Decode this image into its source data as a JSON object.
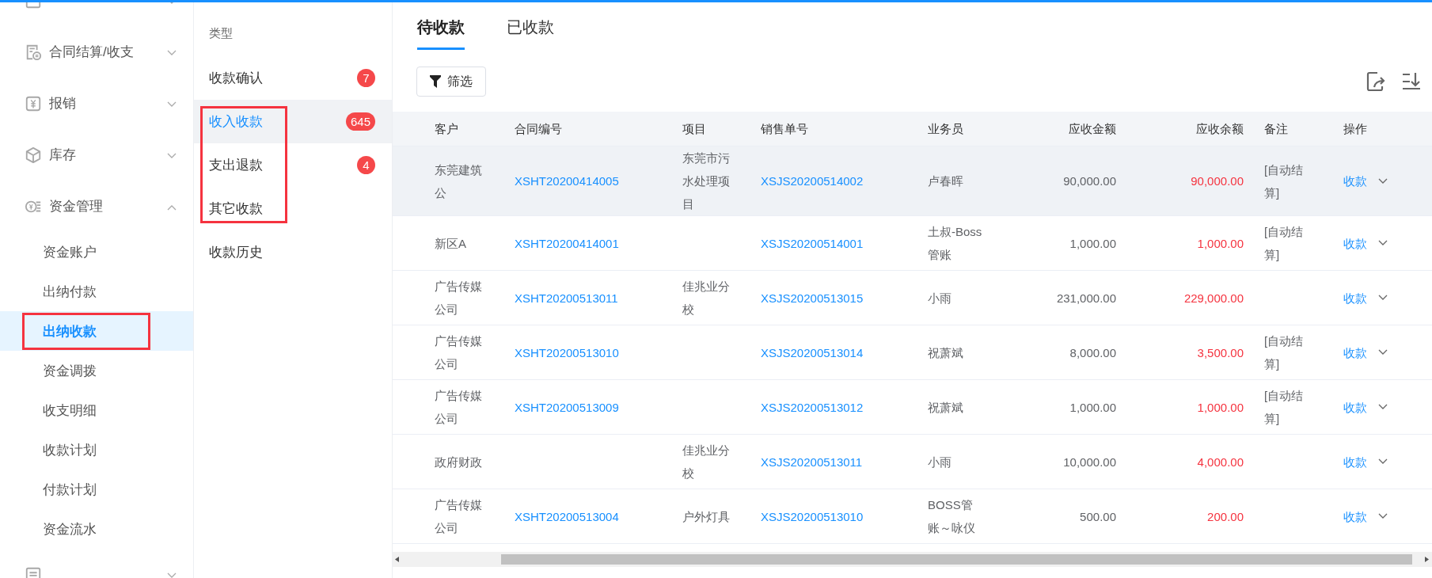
{
  "sidebar": {
    "items": [
      {
        "expanded": false
      },
      {
        "label": "合同结算/收支",
        "expanded": false
      },
      {
        "label": "报销",
        "expanded": false
      },
      {
        "label": "库存",
        "expanded": false
      },
      {
        "label": "资金管理",
        "expanded": true,
        "children": [
          {
            "label": "资金账户",
            "selected": false,
            "highlighted": false
          },
          {
            "label": "出纳付款",
            "selected": false,
            "highlighted": false
          },
          {
            "label": "出纳收款",
            "selected": true,
            "highlighted": true
          },
          {
            "label": "资金调拨",
            "selected": false,
            "highlighted": false
          },
          {
            "label": "收支明细",
            "selected": false,
            "highlighted": false
          },
          {
            "label": "收款计划",
            "selected": false,
            "highlighted": false
          },
          {
            "label": "付款计划",
            "selected": false,
            "highlighted": false
          },
          {
            "label": "资金流水",
            "selected": false,
            "highlighted": false
          }
        ]
      },
      {
        "expanded": false
      }
    ]
  },
  "category_panel": {
    "title": "类型",
    "items": [
      {
        "label": "收款确认",
        "count": "7",
        "selected": false,
        "highlighted": false
      },
      {
        "label": "收入收款",
        "count": "645",
        "selected": true,
        "highlighted": true
      },
      {
        "label": "支出退款",
        "count": "4",
        "selected": false,
        "highlighted": true
      },
      {
        "label": "其它收款",
        "selected": false,
        "highlighted": true
      },
      {
        "label": "收款历史",
        "selected": false,
        "highlighted": false
      }
    ]
  },
  "tabs": [
    {
      "label": "待收款",
      "selected": true
    },
    {
      "label": "已收款",
      "selected": false
    }
  ],
  "filter_button": "筛选",
  "table": {
    "columns": [
      "客户",
      "合同编号",
      "项目",
      "销售单号",
      "业务员",
      "应收金额",
      "应收余额",
      "备注",
      "操作"
    ],
    "rows": [
      {
        "hovered": true,
        "customer": "东莞建筑公",
        "contract_no": "XSHT20200414005",
        "project": "东莞市污水处理项目",
        "sales_no": "XSJS20200514002",
        "salesperson": "卢春晖",
        "amount": "90,000.00",
        "balance": "90,000.00",
        "note": "[自动结算]",
        "action": "收款"
      },
      {
        "hovered": false,
        "customer": "新区A",
        "contract_no": "XSHT20200414001",
        "sales_no": "XSJS20200514001",
        "salesperson": "土叔-Boss管账",
        "amount": "1,000.00",
        "balance": "1,000.00",
        "note": "[自动结算]",
        "action": "收款"
      },
      {
        "hovered": false,
        "customer": "广告传媒公司",
        "contract_no": "XSHT20200513011",
        "project": "佳兆业分校",
        "sales_no": "XSJS20200513015",
        "salesperson": "小雨",
        "amount": "231,000.00",
        "balance": "229,000.00",
        "action": "收款"
      },
      {
        "hovered": false,
        "customer": "广告传媒公司",
        "contract_no": "XSHT20200513010",
        "sales_no": "XSJS20200513014",
        "salesperson": "祝萧斌",
        "amount": "8,000.00",
        "balance": "3,500.00",
        "note": "[自动结算]",
        "action": "收款"
      },
      {
        "hovered": false,
        "customer": "广告传媒公司",
        "contract_no": "XSHT20200513009",
        "sales_no": "XSJS20200513012",
        "salesperson": "祝萧斌",
        "amount": "1,000.00",
        "balance": "1,000.00",
        "note": "[自动结算]",
        "action": "收款"
      },
      {
        "hovered": false,
        "customer": "政府财政",
        "project": "佳兆业分校",
        "sales_no": "XSJS20200513011",
        "salesperson": "小雨",
        "amount": "10,000.00",
        "balance": "4,000.00",
        "action": "收款"
      },
      {
        "hovered": false,
        "customer": "广告传媒公司",
        "contract_no": "XSHT20200513004",
        "project": "户外灯具",
        "sales_no": "XSJS20200513010",
        "salesperson": "BOSS管账～咏仪",
        "amount": "500.00",
        "balance": "200.00",
        "action": "收款"
      }
    ]
  }
}
